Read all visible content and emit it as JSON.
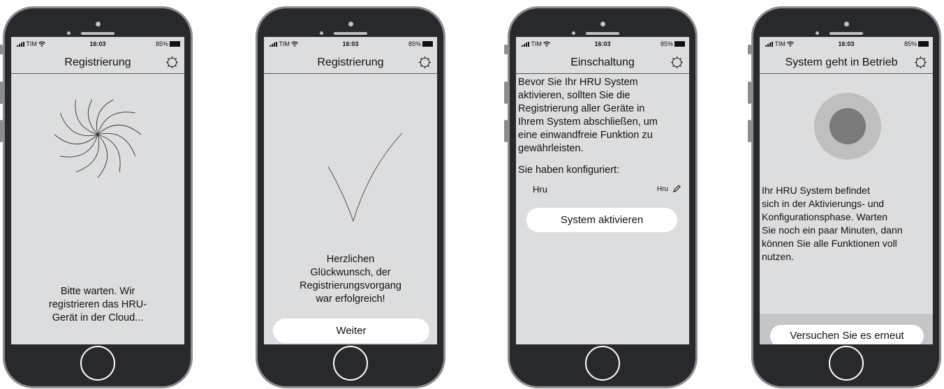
{
  "screens": [
    {
      "status": {
        "carrier": "TIM",
        "time": "16:03",
        "battery": "85%"
      },
      "title": "Registrierung",
      "message": [
        "Bitte warten. Wir",
        "registrieren das HRU-",
        "Gerät in der Cloud..."
      ]
    },
    {
      "status": {
        "carrier": "TIM",
        "time": "16:03",
        "battery": "85%"
      },
      "title": "Registrierung",
      "message": [
        "Herzlichen",
        "Glückwunsch, der",
        "Registrierungsvorgang",
        "war erfolgreich!"
      ],
      "button": "Weiter"
    },
    {
      "status": {
        "carrier": "TIM",
        "time": "16:03",
        "battery": "85%"
      },
      "title": "Einschaltung",
      "paragraph": [
        "Bevor Sie Ihr HRU System",
        "aktivieren, sollten Sie die",
        "Registrierung aller Geräte in",
        "Ihrem System abschließen, um",
        "eine einwandfreie Funktion zu",
        "gewährleisten."
      ],
      "configured_label": "Sie haben konfiguriert:",
      "device": {
        "name": "Hru",
        "type": "Hru"
      },
      "button": "System aktivieren"
    },
    {
      "status": {
        "carrier": "TIM",
        "time": "16:03",
        "battery": "85%"
      },
      "title": "System geht in Betrieb",
      "paragraph": [
        "Ihr HRU System befindet",
        "sich in der Aktivierungs- und",
        "Konfigurationsphase. Warten",
        "Sie noch ein paar Minuten, dann",
        "können Sie alle Funktionen voll",
        "nutzen."
      ],
      "button": "Versuchen Sie es erneut"
    }
  ]
}
